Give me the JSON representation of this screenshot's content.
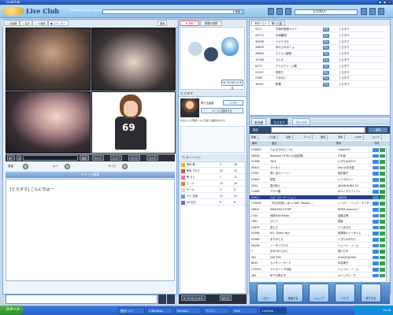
{
  "window": {
    "title": "LiveClub"
  },
  "header": {
    "brand": "Live Club",
    "tagline": "Karaoke social network",
    "search_label": "検索",
    "user_count": "1/100人"
  },
  "cam_tabs": [
    "□ 全画面",
    "□ 拡大",
    "□ 小画面",
    "● ステッカー",
    "動画"
  ],
  "player_controls": {
    "buttons": [
      "設定",
      "ボイス",
      "エコー",
      "マイク",
      "カメラ"
    ],
    "volume": "音量",
    "mic_label": "マイク",
    "key_label": "キー"
  },
  "chat": {
    "header": "チャット画面",
    "message": "[とらタマ] こんにちはー"
  },
  "mid": {
    "tab_active": "★ 予約",
    "tab_other": "歌唱の投票",
    "present_button": "★ プレゼントする",
    "user_name": "とらタマ",
    "fans_label": "歌える曲数",
    "fans_value": "1 7 0",
    "room_button": "ルームで招待する",
    "info_line": "お気に入り登録 | マイ日記 | 電話をかける",
    "present_list_header": "プレゼントリスト",
    "present_rows": [
      {
        "name": "黄色 橙",
        "count": "2",
        "points": "18"
      },
      {
        "name": "和色 でもう",
        "count": "20",
        "points": "20"
      },
      {
        "name": "歌 もう",
        "count": "1",
        "points": "11"
      },
      {
        "name": "ビール",
        "count": "24",
        "points": "24"
      },
      {
        "name": "ケーキ",
        "count": "3",
        "points": "8"
      },
      {
        "name": "ペリ 花束",
        "count": "21",
        "points": "21"
      },
      {
        "name": "AV 紅白",
        "count": "6",
        "points": "6"
      }
    ],
    "bottom_left": "★ プレゼントする",
    "bottom_right": "続ける"
  },
  "right_top": {
    "tabs": [
      "予約リスト",
      "歌った曲"
    ],
    "rows": [
      {
        "num": "5327",
        "title": "手塚が無償ヤヤト",
        "user": "とらタマ"
      },
      {
        "num": "26774",
        "title": "天体観測",
        "user": "とらタマ"
      },
      {
        "num": "30408",
        "title": "ハナミズキ",
        "user": "とらタマ"
      },
      {
        "num": "26893",
        "title": "歩の上のポニョ",
        "user": "とらタマ"
      },
      {
        "num": "26884",
        "title": "さくら (独唱)",
        "user": "とらタマ"
      },
      {
        "num": "10768",
        "title": "ラムネ",
        "user": "とらタマ"
      },
      {
        "num": "8473",
        "title": "アイスクリーム戦",
        "user": "とらタマ"
      },
      {
        "num": "22327",
        "title": "夏祭り",
        "user": "とらタマ"
      },
      {
        "num": "2188",
        "title": "つなない",
        "user": "とらタマ"
      },
      {
        "num": "16921",
        "title": "粉雪",
        "user": "とらタマ"
      }
    ],
    "badge": "再生"
  },
  "karaoke": {
    "tabs": [
      "参加者",
      "カラオケ",
      "フレンド"
    ],
    "search_label": "曲名",
    "search_button": "検索",
    "categories": [
      "新曲",
      "人気曲",
      "演歌",
      "アニメ",
      "童謡",
      "洋楽",
      "J-POP",
      "ロック"
    ],
    "col_headers": [
      "番号",
      "曲名",
      "歌手",
      "予約"
    ],
    "rows": [
      {
        "num": "539843",
        "title": "さよならのむこうに",
        "artist": "supercell"
      },
      {
        "num": "90826",
        "title": "Because Of You (以前説明)",
        "artist": "千本桜"
      },
      {
        "num": "91356",
        "title": "YELL",
        "artist": "いきものがかり"
      },
      {
        "num": "90923",
        "title": "ライオン",
        "artist": "May'n/中島愛"
      },
      {
        "num": "22367",
        "title": "思い出ストーリー",
        "artist": "松田聖子"
      },
      {
        "num": "91903",
        "title": "桜雪",
        "artist": "レミオロメン"
      },
      {
        "num": "5954",
        "title": "君が紡ぐ",
        "artist": "ASIAN KUNG-FU"
      },
      {
        "num": "11468",
        "title": "アゲハ蝶",
        "artist": "ポルノグラフィティ"
      },
      {
        "num": "92927",
        "title": "ヘビーローテーション",
        "artist": "AKB48"
      },
      {
        "num": "174838",
        "title": "「紅白を読む (木 x GIKI) (Rewka ...",
        "artist": "シンガー・ソング・ライター"
      },
      {
        "num": "18645",
        "title": "ENDLESS STORY",
        "artist": "REIRA starring Y"
      },
      {
        "num": "2744",
        "title": "地球SUN Radio",
        "artist": "遠藤正明"
      },
      {
        "num": "7081",
        "title": "ひとつ",
        "artist": "童謡"
      },
      {
        "num": "22839",
        "title": "見と心",
        "artist": "つじあやの"
      },
      {
        "num": "93098",
        "title": "NO, Thank You!",
        "artist": "放課後ティータイム"
      },
      {
        "num": "92480",
        "title": "ありがとう",
        "artist": "いきものがかり"
      },
      {
        "num": "90208",
        "title": "ノーザンクロス",
        "artist": "シェリル・ノーム"
      },
      {
        "num": "7",
        "title": "お手やわらかに",
        "artist": "夏川りみ"
      },
      {
        "num": "381",
        "title": "DAY YES",
        "artist": "CHAGE&ASKA"
      },
      {
        "num": "6093",
        "title": "カンサリーロード",
        "artist": "本名陽子"
      },
      {
        "num": "172923",
        "title": "ライオン (~PV版)",
        "artist": "シェリル・ノーム"
      },
      {
        "num": "482",
        "title": "年下の男の子",
        "artist": "キャンディーズ"
      }
    ],
    "footer_buttons": [
      "ロビー",
      "来客する",
      "ショップ",
      "ヘルプ",
      "終了する"
    ]
  },
  "taskbar": {
    "start": "スタート",
    "items": [
      "受信トレイ",
      "2 Windows",
      "Microso...",
      "ワスプ...",
      "Paint",
      "LiveClub"
    ],
    "clock": "16:28"
  }
}
